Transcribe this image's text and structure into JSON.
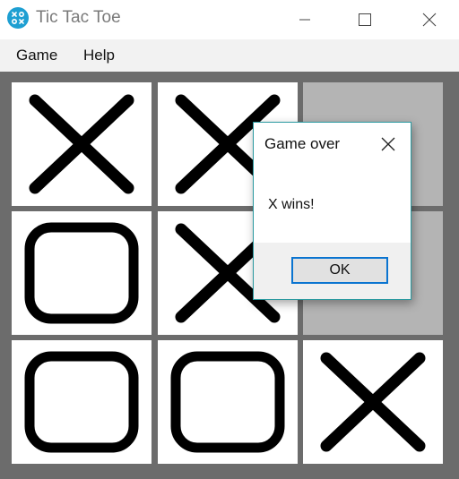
{
  "window": {
    "title": "Tic Tac Toe",
    "icon": "app-icon",
    "controls": [
      "minimize-icon",
      "maximize-icon",
      "close-icon"
    ]
  },
  "menu": {
    "items": [
      {
        "label": "Game"
      },
      {
        "label": "Help"
      }
    ]
  },
  "board": {
    "cells": [
      {
        "mark": "X"
      },
      {
        "mark": "X"
      },
      {
        "mark": ""
      },
      {
        "mark": "O"
      },
      {
        "mark": "X"
      },
      {
        "mark": ""
      },
      {
        "mark": "O"
      },
      {
        "mark": "O"
      },
      {
        "mark": "X"
      }
    ]
  },
  "dialog": {
    "title": "Game over",
    "message": "X wins!",
    "ok_label": "OK"
  },
  "colors": {
    "board_background": "#6c6c6c",
    "empty_cell": "#b4b4b4",
    "accent": "#0a74d0",
    "dialog_border": "#2a9aa0",
    "app_icon": "#1e9fd2"
  }
}
